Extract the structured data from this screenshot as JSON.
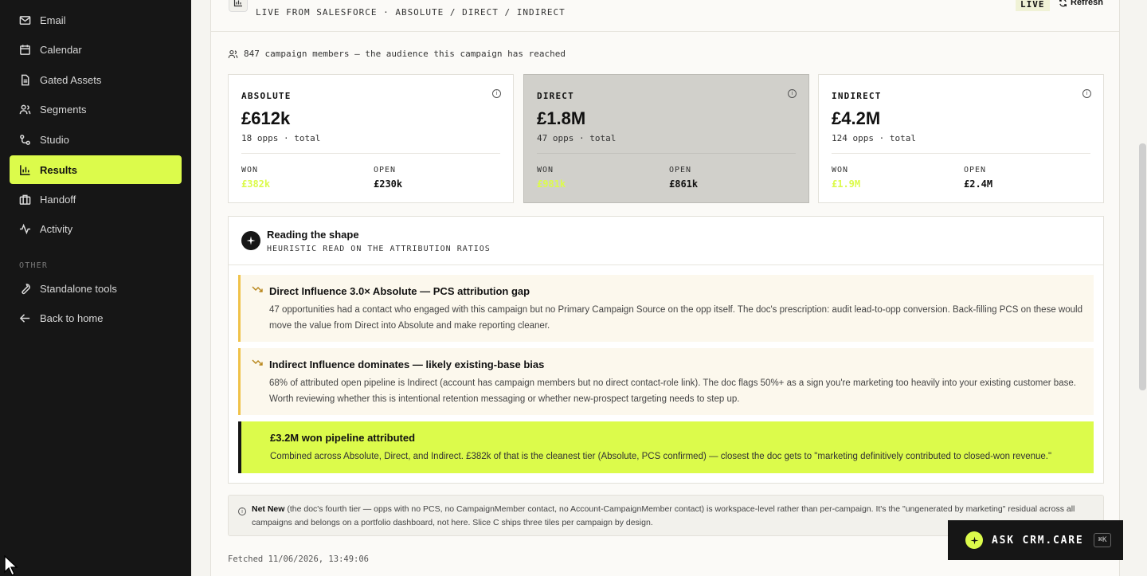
{
  "sidebar": {
    "items": [
      {
        "label": "Email",
        "icon": "mail-icon"
      },
      {
        "label": "Calendar",
        "icon": "calendar-icon"
      },
      {
        "label": "Gated Assets",
        "icon": "document-icon"
      },
      {
        "label": "Segments",
        "icon": "users-icon"
      },
      {
        "label": "Studio",
        "icon": "share-icon"
      },
      {
        "label": "Results",
        "icon": "bar-chart-icon",
        "active": true
      },
      {
        "label": "Handoff",
        "icon": "briefcase-icon"
      },
      {
        "label": "Activity",
        "icon": "activity-icon"
      }
    ],
    "section_label": "OTHER",
    "other_items": [
      {
        "label": "Standalone tools",
        "icon": "wrench-icon"
      },
      {
        "label": "Back to home",
        "icon": "arrow-left-icon"
      }
    ]
  },
  "header": {
    "subtitle": "LIVE FROM SALESFORCE · ABSOLUTE / DIRECT / INDIRECT",
    "live_badge": "LIVE",
    "refresh_label": "Refresh"
  },
  "members_text": "847 campaign members — the audience this campaign has reached",
  "cards": [
    {
      "title": "ABSOLUTE",
      "value": "£612k",
      "sub": "18 opps · total",
      "won_label": "WON",
      "won_value": "£382k",
      "open_label": "OPEN",
      "open_value": "£230k"
    },
    {
      "title": "DIRECT",
      "value": "£1.8M",
      "sub": "47 opps · total",
      "won_label": "WON",
      "won_value": "£981k",
      "open_label": "OPEN",
      "open_value": "£861k"
    },
    {
      "title": "INDIRECT",
      "value": "£4.2M",
      "sub": "124 opps · total",
      "won_label": "WON",
      "won_value": "£1.9M",
      "open_label": "OPEN",
      "open_value": "£2.4M"
    }
  ],
  "shape": {
    "title": "Reading the shape",
    "subtitle": "HEURISTIC READ ON THE ATTRIBUTION RATIOS",
    "insights": [
      {
        "title": "Direct Influence 3.0× Absolute — PCS attribution gap",
        "body": "47 opportunities had a contact who engaged with this campaign but no Primary Campaign Source on the opp itself. The doc's prescription: audit lead-to-opp conversion. Back-filling PCS on these would move the value from Direct into Absolute and make reporting cleaner."
      },
      {
        "title": "Indirect Influence dominates — likely existing-base bias",
        "body": "68% of attributed open pipeline is Indirect (account has campaign members but no direct contact-role link). The doc flags 50%+ as a sign you're marketing too heavily into your existing customer base. Worth reviewing whether this is intentional retention messaging or whether new-prospect targeting needs to step up."
      },
      {
        "title": "£3.2M won pipeline attributed",
        "body": "Combined across Absolute, Direct, and Indirect. £382k of that is the cleanest tier (Absolute, PCS confirmed) — closest the doc gets to \"marketing definitively contributed to closed-won revenue.\""
      }
    ]
  },
  "note": {
    "bold": "Net New",
    "text": " (the doc's fourth tier — opps with no PCS, no CampaignMember contact, no Account-CampaignMember contact) is workspace-level rather than per-campaign. It's the \"ungenerated by marketing\" residual across all campaigns and belongs on a portfolio dashboard, not here. Slice C ships three tiles per campaign by design."
  },
  "fetched": "Fetched 11/06/2026, 13:49:06",
  "ask": {
    "label": "ASK CRM.CARE",
    "shortcut": "⌘K"
  },
  "colors": {
    "accent": "#dcfb4b",
    "sidebar_bg": "#161616",
    "warn_border": "#f0c24a"
  }
}
